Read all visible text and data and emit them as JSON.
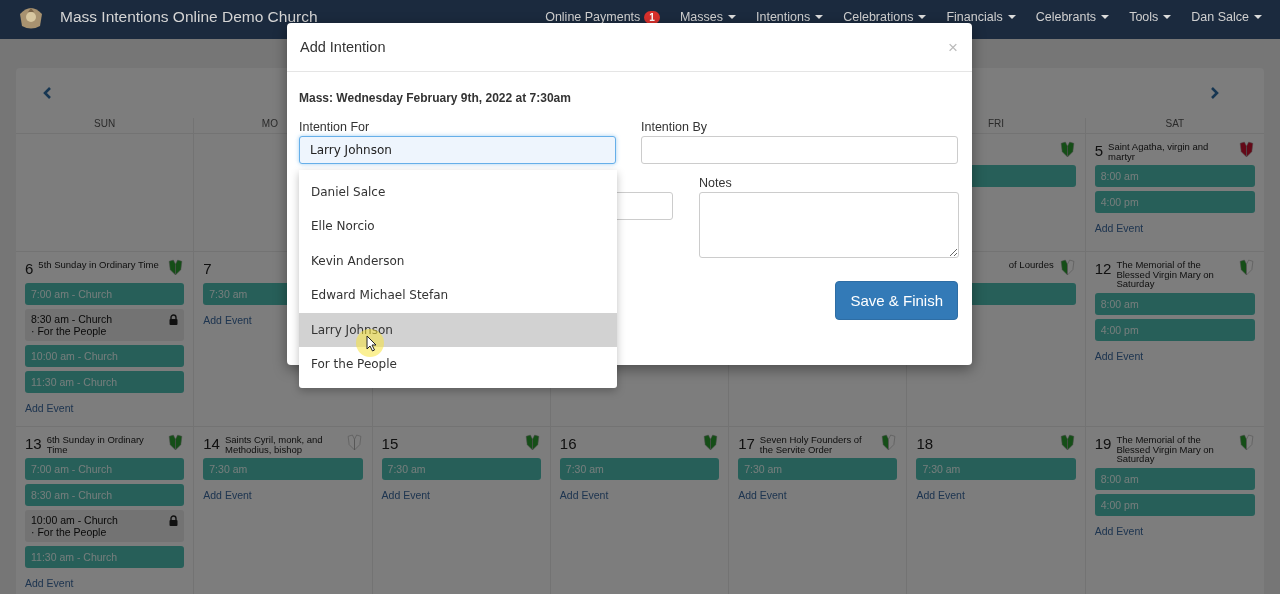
{
  "navbar": {
    "brand": "Mass Intentions Online Demo Church",
    "menu": [
      {
        "label": "Online Payments",
        "badge": "1",
        "dropdown": false
      },
      {
        "label": "Masses",
        "dropdown": true
      },
      {
        "label": "Intentions",
        "dropdown": true
      },
      {
        "label": "Celebrations",
        "dropdown": true
      },
      {
        "label": "Financials",
        "dropdown": true
      },
      {
        "label": "Celebrants",
        "dropdown": true
      },
      {
        "label": "Tools",
        "dropdown": true
      },
      {
        "label": "Dan Salce",
        "dropdown": true
      }
    ]
  },
  "calendar": {
    "weekdays": {
      "sun": "SUN",
      "mon": "MO",
      "fri": "FRI",
      "sat": "SAT"
    },
    "weeks": [
      {
        "fri": {
          "vestment": {
            "kind": "green"
          },
          "events": [
            {
              "kind": "mass"
            }
          ]
        },
        "sat": {
          "number": "5",
          "title": "Saint Agatha, virgin and martyr",
          "vestment": {
            "kind": "red"
          },
          "events": [
            {
              "kind": "mass",
              "label": "8:00 am"
            },
            {
              "kind": "mass",
              "label": "4:00 pm"
            }
          ],
          "add_event": "Add Event"
        }
      },
      {
        "sun": {
          "number": "6",
          "title": "5th Sunday in Ordinary Time",
          "vestment": {
            "kind": "green"
          },
          "events": [
            {
              "kind": "mass",
              "label": "7:00 am - Church"
            },
            {
              "kind": "booked",
              "label": "8:30 am - Church",
              "intention": "· For the People"
            },
            {
              "kind": "mass",
              "label": "10:00 am - Church"
            },
            {
              "kind": "mass",
              "label": "11:30 am - Church"
            }
          ],
          "add_event": "Add Event"
        },
        "mon": {
          "number": "7",
          "events": [
            {
              "kind": "mass",
              "label": "7:30 am"
            }
          ],
          "add_event": "Add Event"
        },
        "fri": {
          "title": "of Lourdes",
          "vestment": {
            "kind": "split"
          },
          "events": [
            {
              "kind": "mass"
            }
          ]
        },
        "sat": {
          "number": "12",
          "title": "The Memorial of the Blessed Virgin Mary on Saturday",
          "vestment": {
            "kind": "split"
          },
          "events": [
            {
              "kind": "mass",
              "label": "8:00 am"
            },
            {
              "kind": "mass",
              "label": "4:00 pm"
            }
          ],
          "add_event": "Add Event"
        }
      },
      {
        "sun": {
          "number": "13",
          "title": "6th Sunday in Ordinary Time",
          "vestment": {
            "kind": "green"
          },
          "events": [
            {
              "kind": "mass",
              "label": "7:00 am - Church"
            },
            {
              "kind": "mass",
              "label": "8:30 am - Church"
            },
            {
              "kind": "booked",
              "label": "10:00 am - Church",
              "intention": "· For the People"
            },
            {
              "kind": "mass",
              "label": "11:30 am - Church"
            }
          ],
          "add_event": "Add Event"
        },
        "mon": {
          "number": "14",
          "title": "Saints Cyril, monk, and Methodius, bishop",
          "vestment": {
            "kind": "white"
          },
          "events": [
            {
              "kind": "mass",
              "label": "7:30 am"
            }
          ],
          "add_event": "Add Event"
        },
        "tue": {
          "number": "15",
          "vestment": {
            "kind": "green"
          },
          "events": [
            {
              "kind": "mass",
              "label": "7:30 am"
            }
          ],
          "add_event": "Add Event"
        },
        "wed": {
          "number": "16",
          "vestment": {
            "kind": "green"
          },
          "events": [
            {
              "kind": "mass",
              "label": "7:30 am"
            }
          ],
          "add_event": "Add Event"
        },
        "thu": {
          "number": "17",
          "title": "Seven Holy Founders of the Servite Order",
          "vestment": {
            "kind": "split"
          },
          "events": [
            {
              "kind": "mass",
              "label": "7:30 am"
            }
          ],
          "add_event": "Add Event"
        },
        "fri": {
          "number": "18",
          "vestment": {
            "kind": "green"
          },
          "events": [
            {
              "kind": "mass",
              "label": "7:30 am"
            }
          ],
          "add_event": "Add Event"
        },
        "sat": {
          "number": "19",
          "title": "The Memorial of the Blessed Virgin Mary on Saturday",
          "vestment": {
            "kind": "split"
          },
          "events": [
            {
              "kind": "mass",
              "label": "8:00 am"
            },
            {
              "kind": "mass",
              "label": "4:00 pm"
            }
          ],
          "add_event": "Add Event"
        }
      }
    ]
  },
  "modal": {
    "title": "Add Intention",
    "close": "×",
    "mass": "Mass: Wednesday February 9th, 2022 at 7:30am",
    "intention_for": {
      "label": "Intention For",
      "value": "Larry Johnson",
      "focused": true
    },
    "intention_by": {
      "label": "Intention By",
      "focused": false
    },
    "field_3": {
      "focused": false
    },
    "notes": {
      "label": "Notes"
    },
    "save_button": "Save & Finish"
  },
  "suggestions": [
    {
      "label": "Daniel Salce",
      "selected": false
    },
    {
      "label": "Elle Norcio",
      "selected": false
    },
    {
      "label": "Kevin Anderson",
      "selected": false
    },
    {
      "label": "Edward Michael Stefan",
      "selected": false
    },
    {
      "label": "Larry Johnson",
      "selected": true
    },
    {
      "label": "For the People",
      "selected": false
    }
  ]
}
